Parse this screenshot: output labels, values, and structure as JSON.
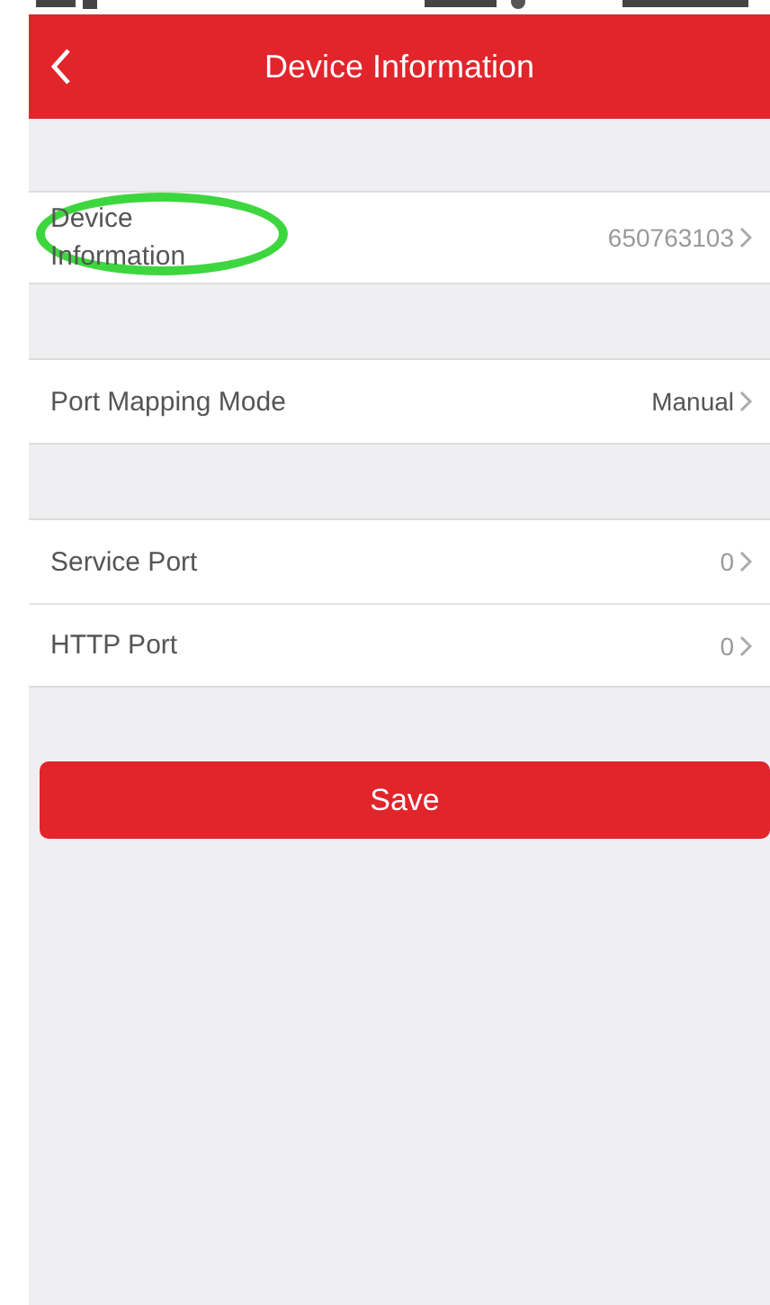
{
  "header": {
    "title": "Device Information"
  },
  "groups": [
    {
      "rows": [
        {
          "label": "Device Information",
          "value": "650763103",
          "highlighted": true
        }
      ]
    },
    {
      "rows": [
        {
          "label": "Port Mapping Mode",
          "value": "Manual",
          "highlighted": false
        }
      ]
    },
    {
      "rows": [
        {
          "label": "Service Port",
          "value": "0",
          "highlighted": false
        },
        {
          "label": "HTTP Port",
          "value": "0",
          "highlighted": false
        }
      ]
    }
  ],
  "save_button": {
    "label": "Save"
  }
}
